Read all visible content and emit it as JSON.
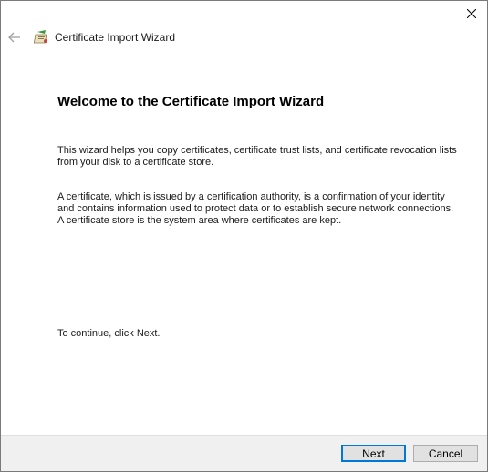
{
  "window": {
    "title": "Certificate Import Wizard"
  },
  "icons": {
    "back": "back-arrow-icon",
    "wizard": "certificate-wizard-icon",
    "close": "close-icon"
  },
  "content": {
    "heading": "Welcome to the Certificate Import Wizard",
    "paragraph1": "This wizard helps you copy certificates, certificate trust lists, and certificate revocation lists from your disk to a certificate store.",
    "paragraph2": "A certificate, which is issued by a certification authority, is a confirmation of your identity and contains information used to protect data or to establish secure network connections. A certificate store is the system area where certificates are kept.",
    "paragraph3": "To continue, click Next."
  },
  "buttons": {
    "next": "Next",
    "cancel": "Cancel"
  },
  "colors": {
    "accent": "#0078d7",
    "footer_bg": "#f0f0f0",
    "button_bg": "#e1e1e1"
  }
}
